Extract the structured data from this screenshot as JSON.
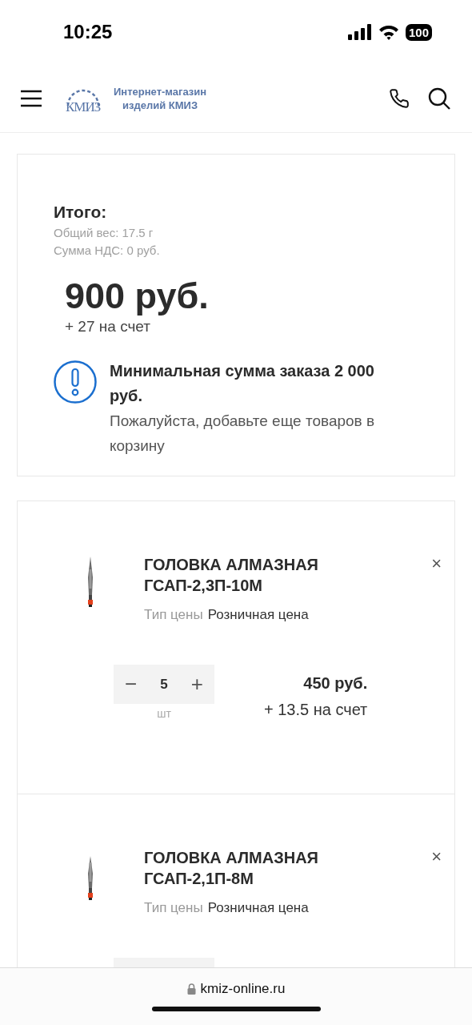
{
  "status_bar": {
    "time": "10:25",
    "battery": "100"
  },
  "header": {
    "logo_mark": "КМИЗ",
    "logo_text": [
      "Интернет-магазин",
      "изделий КМИЗ"
    ]
  },
  "summary": {
    "title": "Итого:",
    "details": [
      "Общий вес: 17.5 г",
      "Сумма НДС: 0 руб."
    ],
    "total": "900 руб.",
    "bonus": "+ 27 на счет",
    "notice": {
      "title": "Минимальная сумма заказа 2 000 руб.",
      "text": "Пожалуйста, добавьте еще товаров в корзину"
    }
  },
  "items": [
    {
      "name": "ГОЛОВКА АЛМАЗНАЯ ГСАП-2,3П-10М",
      "price_type_label": "Тип цены",
      "price_type": "Розничная цена",
      "quantity": "5",
      "minus": "−",
      "plus": "+",
      "unit": "шт",
      "price": "450 руб.",
      "bonus": "+ 13.5 на счет",
      "remove": "×"
    },
    {
      "name": "ГОЛОВКА АЛМАЗНАЯ ГСАП-2,1П-8М",
      "price_type_label": "Тип цены",
      "price_type": "Розничная цена",
      "remove": "×"
    }
  ],
  "browser_bar": {
    "url": "kmiz-online.ru"
  }
}
